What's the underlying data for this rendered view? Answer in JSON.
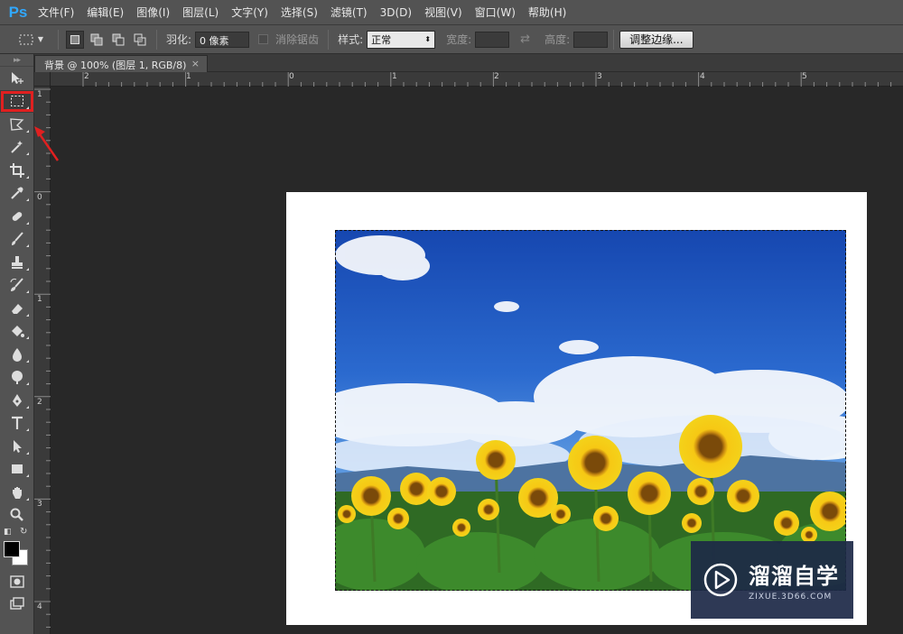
{
  "app": {
    "logo": "Ps"
  },
  "menu": [
    "文件(F)",
    "编辑(E)",
    "图像(I)",
    "图层(L)",
    "文字(Y)",
    "选择(S)",
    "滤镜(T)",
    "3D(D)",
    "视图(V)",
    "窗口(W)",
    "帮助(H)"
  ],
  "options": {
    "feather_label": "羽化:",
    "feather_value": "0 像素",
    "antialias_label": "消除锯齿",
    "style_label": "样式:",
    "style_value": "正常",
    "width_label": "宽度:",
    "height_label": "高度:",
    "refine_edge": "调整边缘..."
  },
  "document": {
    "tab_title": "背景 @ 100% (图层 1, RGB/8) *",
    "close": "×"
  },
  "ruler": {
    "top_labels": [
      "2",
      "1",
      "0",
      "1",
      "2",
      "3",
      "4",
      "5"
    ],
    "left_labels": [
      "1",
      "0",
      "1",
      "2",
      "3",
      "4"
    ]
  },
  "tools": [
    "move-icon",
    "rect-marquee-icon",
    "lasso-icon",
    "magic-wand-icon",
    "crop-icon",
    "eyedropper-icon",
    "healing-icon",
    "brush-icon",
    "stamp-icon",
    "history-brush-icon",
    "eraser-icon",
    "paint-bucket-icon",
    "blur-icon",
    "dodge-icon",
    "pen-icon",
    "type-icon",
    "path-select-icon",
    "shape-icon",
    "hand-icon",
    "zoom-icon"
  ],
  "watermark": {
    "title": "溜溜自学",
    "subtitle": "ZIXUE.3D66.COM"
  },
  "colors": {
    "highlight": "#e02020",
    "ps_blue": "#31a8ff"
  }
}
